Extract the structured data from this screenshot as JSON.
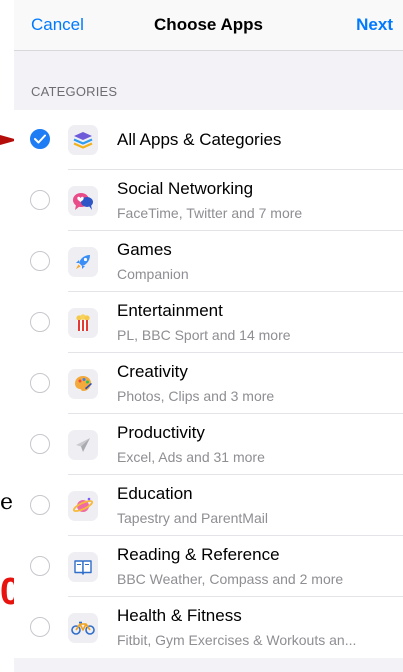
{
  "nav": {
    "cancel": "Cancel",
    "title": "Choose Apps",
    "next": "Next"
  },
  "section_header": "CATEGORIES",
  "categories": [
    {
      "title": "All Apps & Categories",
      "subtitle": "",
      "checked": true,
      "icon": "stack-icon"
    },
    {
      "title": "Social Networking",
      "subtitle": "FaceTime, Twitter and 7 more",
      "checked": false,
      "icon": "chat-bubble-icon"
    },
    {
      "title": "Games",
      "subtitle": "Companion",
      "checked": false,
      "icon": "rocket-icon"
    },
    {
      "title": "Entertainment",
      "subtitle": "PL, BBC Sport and 14 more",
      "checked": false,
      "icon": "popcorn-icon"
    },
    {
      "title": "Creativity",
      "subtitle": "Photos, Clips and 3 more",
      "checked": false,
      "icon": "palette-icon"
    },
    {
      "title": "Productivity",
      "subtitle": "Excel, Ads and 31 more",
      "checked": false,
      "icon": "paper-plane-icon"
    },
    {
      "title": "Education",
      "subtitle": "Tapestry and ParentMail",
      "checked": false,
      "icon": "planet-icon"
    },
    {
      "title": "Reading & Reference",
      "subtitle": "BBC Weather, Compass and 2 more",
      "checked": false,
      "icon": "book-icon"
    },
    {
      "title": "Health & Fitness",
      "subtitle": "Fitbit, Gym Exercises & Workouts an...",
      "checked": false,
      "icon": "bicycle-icon"
    }
  ],
  "colors": {
    "accent": "#007aff",
    "check": "#1e7cf5",
    "annotation": "#e8130f"
  },
  "side_fragments": {
    "left_letter": "e",
    "left_red": "0"
  }
}
